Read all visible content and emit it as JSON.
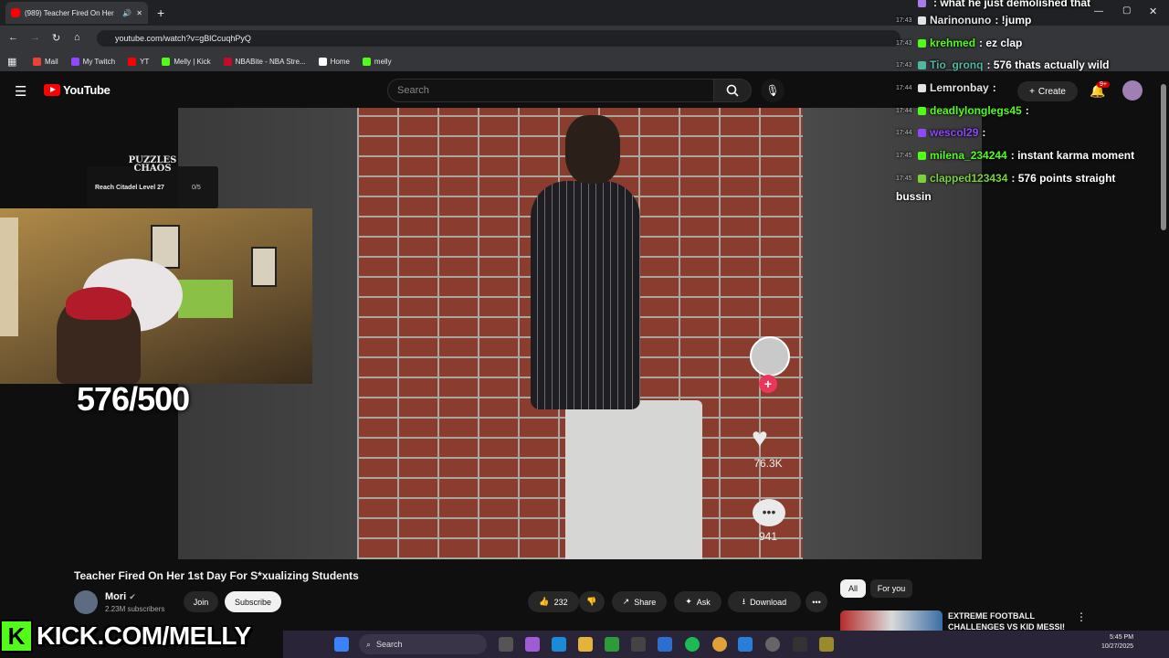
{
  "browser": {
    "tab_title": "(989) Teacher Fired On Her",
    "url": "youtube.com/watch?v=gBlCcuqhPyQ",
    "bookmarks": [
      {
        "label": "Mail",
        "color": "#ea4335"
      },
      {
        "label": "My Twitch",
        "color": "#9146ff"
      },
      {
        "label": "YT",
        "color": "#ff0000"
      },
      {
        "label": "Melly | Kick",
        "color": "#53fc18"
      },
      {
        "label": "NBABite - NBA Stre...",
        "color": "#c9082a"
      },
      {
        "label": "Home",
        "color": "#ffffff"
      },
      {
        "label": "melly",
        "color": "#53fc18"
      }
    ]
  },
  "youtube": {
    "logo": "YouTube",
    "search_placeholder": "Search",
    "create_label": "Create",
    "notif_count": "9+",
    "video_title": "Teacher Fired On Her 1st Day For S*xualizing Students",
    "channel_name": "Mori",
    "channel_subs": "2.23M subscribers",
    "join_label": "Join",
    "subscribe_label": "Subscribe",
    "likes": "232",
    "share_label": "Share",
    "ask_label": "Ask",
    "download_label": "Download",
    "chips": [
      "All",
      "For you"
    ],
    "rec_title": "EXTREME FOOTBALL CHALLENGES VS KID MESSI!"
  },
  "tiktok_overlay": {
    "likes": "76.3K",
    "comments": "941"
  },
  "stream": {
    "puzzle_logo": "PUZZLES CHAOS",
    "puzzle_task": "Reach Citadel Level 27",
    "puzzle_count": "0/5",
    "counter": "576/500",
    "kick_text": "KICK.COM/MELLY"
  },
  "chat": [
    {
      "time": "",
      "user": "",
      "msg": ": what he just demolished that",
      "color": "#a97be6"
    },
    {
      "time": "17:43",
      "user": "Narinonuno",
      "msg": ": !jump",
      "color": "#e3e3e3"
    },
    {
      "time": "17:43",
      "user": "krehmed",
      "msg": ": ez clap",
      "color": "#53fc18"
    },
    {
      "time": "17:43",
      "user": "Tio_gronq",
      "msg": ": 576 thats actually wild",
      "color": "#4fb9a0"
    },
    {
      "time": "17:44",
      "user": "Lemronbay",
      "msg": ":",
      "color": "#e3e3e3"
    },
    {
      "time": "17:44",
      "user": "deadlylonglegs45",
      "msg": ":",
      "color": "#53fc18"
    },
    {
      "time": "17:44",
      "user": "wescol29",
      "msg": ":",
      "color": "#9146ff"
    },
    {
      "time": "17:45",
      "user": "milena_234244",
      "msg": ": instant karma moment",
      "color": "#53fc18"
    },
    {
      "time": "17:45",
      "user": "clapped123434",
      "msg": ": 576 points straight",
      "color": "#7ad33a"
    }
  ],
  "chat_wrap": "bussin",
  "taskbar": {
    "search_label": "Search",
    "time": "5:45 PM",
    "date": "10/27/2025"
  }
}
